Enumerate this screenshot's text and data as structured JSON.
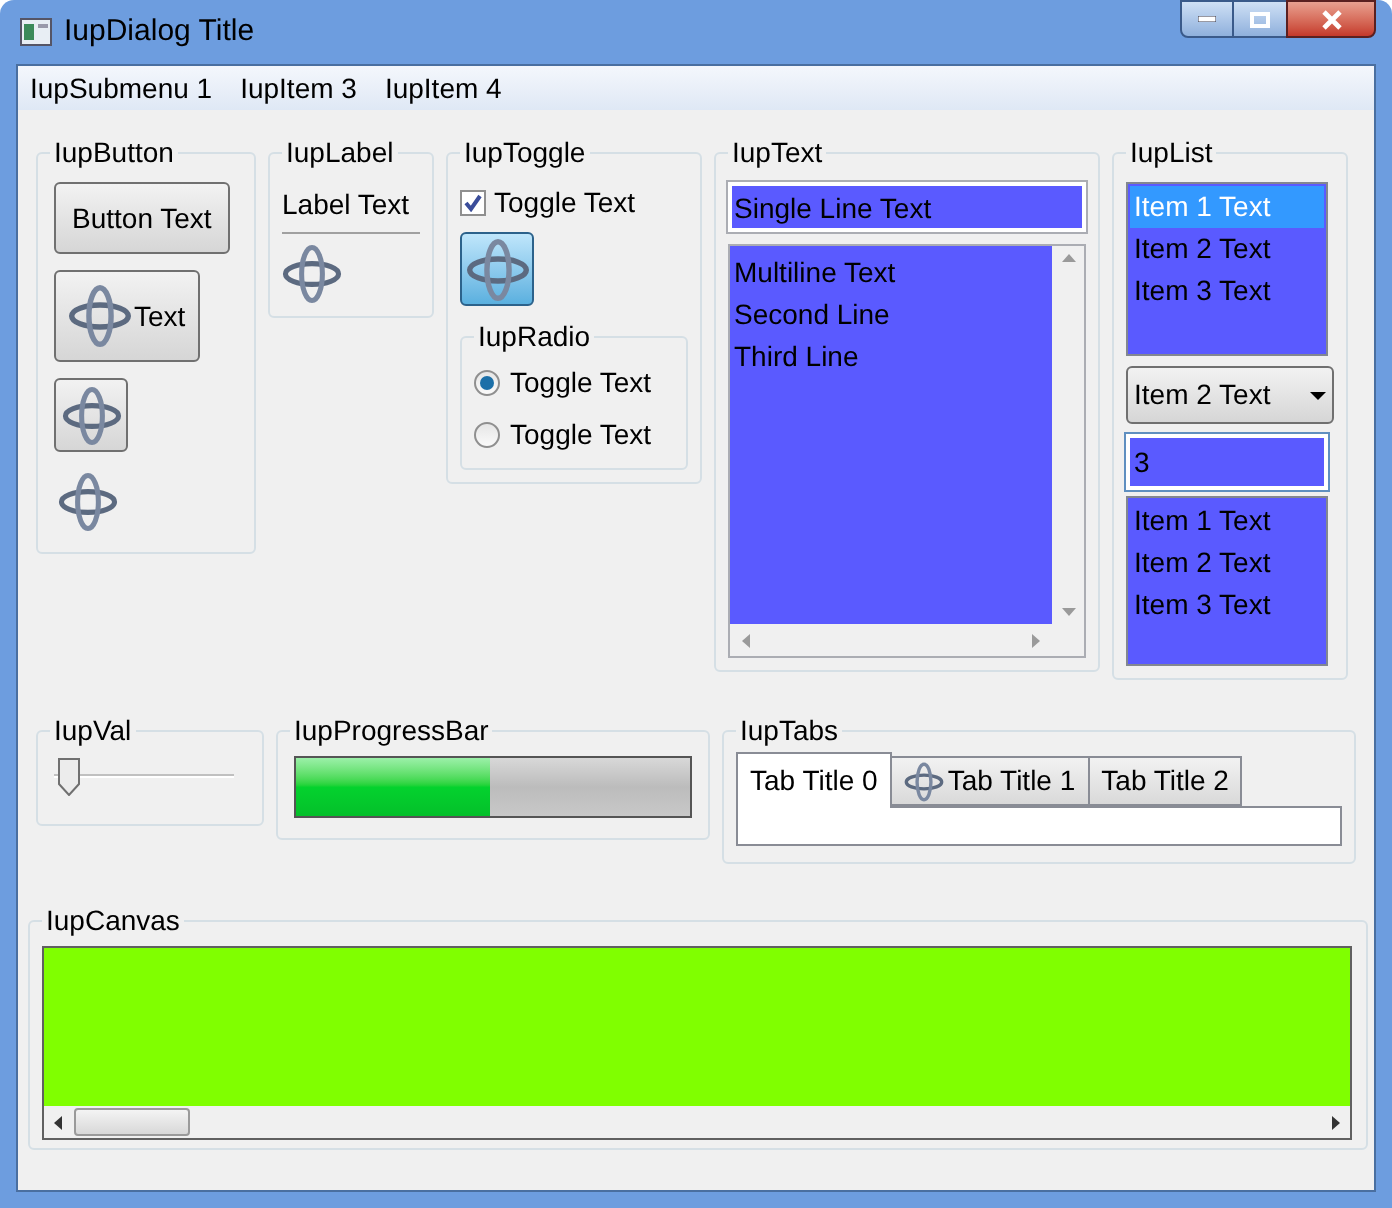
{
  "window": {
    "title": "IupDialog Title"
  },
  "menu": [
    {
      "label": "IupSubmenu 1"
    },
    {
      "label": "IupItem 3"
    },
    {
      "label": "IupItem 4"
    }
  ],
  "button_frame": {
    "title": "IupButton",
    "buttons": [
      {
        "kind": "text",
        "label": "Button Text"
      },
      {
        "kind": "image_text",
        "label": "Text"
      },
      {
        "kind": "image"
      },
      {
        "kind": "flat_image"
      }
    ]
  },
  "label_frame": {
    "title": "IupLabel",
    "label": "Label Text"
  },
  "toggle_frame": {
    "title": "IupToggle",
    "checkbox": {
      "label": "Toggle Text",
      "checked": true
    },
    "image_toggle": {
      "on": true
    },
    "radio": {
      "title": "IupRadio",
      "options": [
        {
          "label": "Toggle Text",
          "selected": true
        },
        {
          "label": "Toggle Text",
          "selected": false
        }
      ]
    }
  },
  "text_frame": {
    "title": "IupText",
    "single_line": "Single Line Text",
    "multiline": [
      "Multiline Text",
      "Second Line",
      "Third Line"
    ]
  },
  "list_frame": {
    "title": "IupList",
    "list": [
      {
        "label": "Item 1 Text",
        "selected": true
      },
      {
        "label": "Item 2 Text",
        "selected": false
      },
      {
        "label": "Item 3 Text",
        "selected": false
      }
    ],
    "dropdown": "Item 2 Text",
    "edit_value": "3",
    "edit_list": [
      {
        "label": "Item 1 Text"
      },
      {
        "label": "Item 2 Text"
      },
      {
        "label": "Item 3 Text"
      }
    ]
  },
  "val_frame": {
    "title": "IupVal",
    "level": 0.02
  },
  "progress_frame": {
    "title": "IupProgressBar",
    "level": 0.49
  },
  "tabs_frame": {
    "title": "IupTabs",
    "tabs": [
      {
        "label": "Tab Title 0",
        "selected": true,
        "has_icon": false
      },
      {
        "label": "Tab Title 1",
        "selected": false,
        "has_icon": true
      },
      {
        "label": "Tab Title 2",
        "selected": false,
        "has_icon": false
      }
    ]
  },
  "canvas_frame": {
    "title": "IupCanvas"
  }
}
